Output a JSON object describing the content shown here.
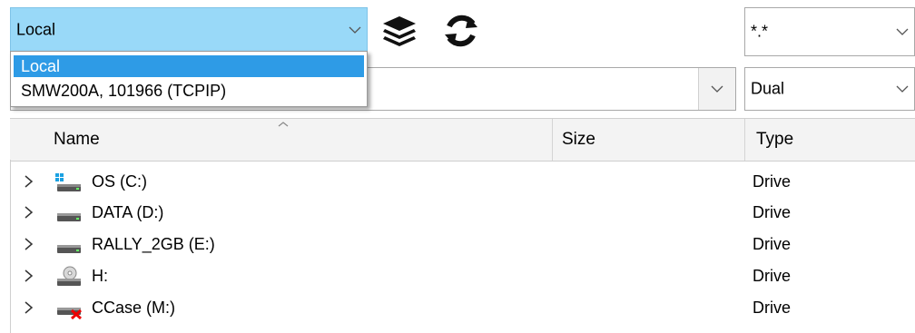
{
  "source": {
    "selected": "Local",
    "options": [
      "Local",
      "SMW200A, 101966 (TCPIP)"
    ]
  },
  "filter": {
    "value": "*.*"
  },
  "path": {
    "value": ""
  },
  "mode": {
    "value": "Dual"
  },
  "toolbar": {
    "icons": [
      "layers-icon",
      "refresh-icon"
    ]
  },
  "columns": {
    "name": "Name",
    "size": "Size",
    "type": "Type"
  },
  "drives": [
    {
      "name": "OS (C:)",
      "size": "",
      "type": "Drive",
      "icon": "windows-drive-icon"
    },
    {
      "name": "DATA (D:)",
      "size": "",
      "type": "Drive",
      "icon": "hard-drive-icon"
    },
    {
      "name": "RALLY_2GB (E:)",
      "size": "",
      "type": "Drive",
      "icon": "hard-drive-icon"
    },
    {
      "name": "H:",
      "size": "",
      "type": "Drive",
      "icon": "cd-drive-icon"
    },
    {
      "name": "CCase (M:)",
      "size": "",
      "type": "Drive",
      "icon": "disconnected-network-drive-icon"
    }
  ],
  "colors": {
    "selection": "#99d9f8",
    "highlight": "#2e9be6"
  }
}
